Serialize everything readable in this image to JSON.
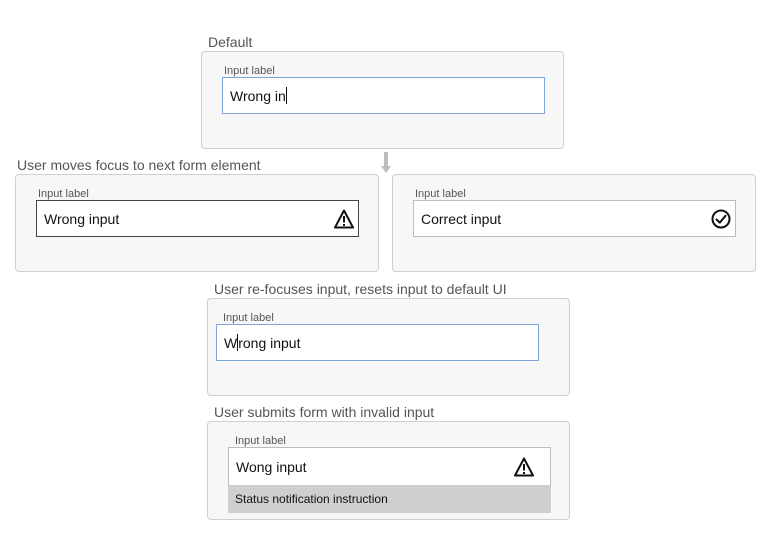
{
  "default": {
    "section": "Default",
    "label": "Input label",
    "value_typed": "Wrong in"
  },
  "blur": {
    "section": "User moves focus to next form element",
    "left": {
      "label": "Input label",
      "value": "Wrong input",
      "icon": "warning-icon"
    },
    "right": {
      "label": "Input label",
      "value": "Correct input",
      "icon": "check-circle-icon"
    }
  },
  "refocus": {
    "section": "User re-focuses input, resets input to default UI",
    "label": "Input label",
    "value_before_caret": "W",
    "value_after_caret": "rong input"
  },
  "submit": {
    "section": "User submits form with invalid input",
    "label": "Input label",
    "value": "Wong input",
    "icon": "warning-icon",
    "status": "Status notification instruction"
  }
}
